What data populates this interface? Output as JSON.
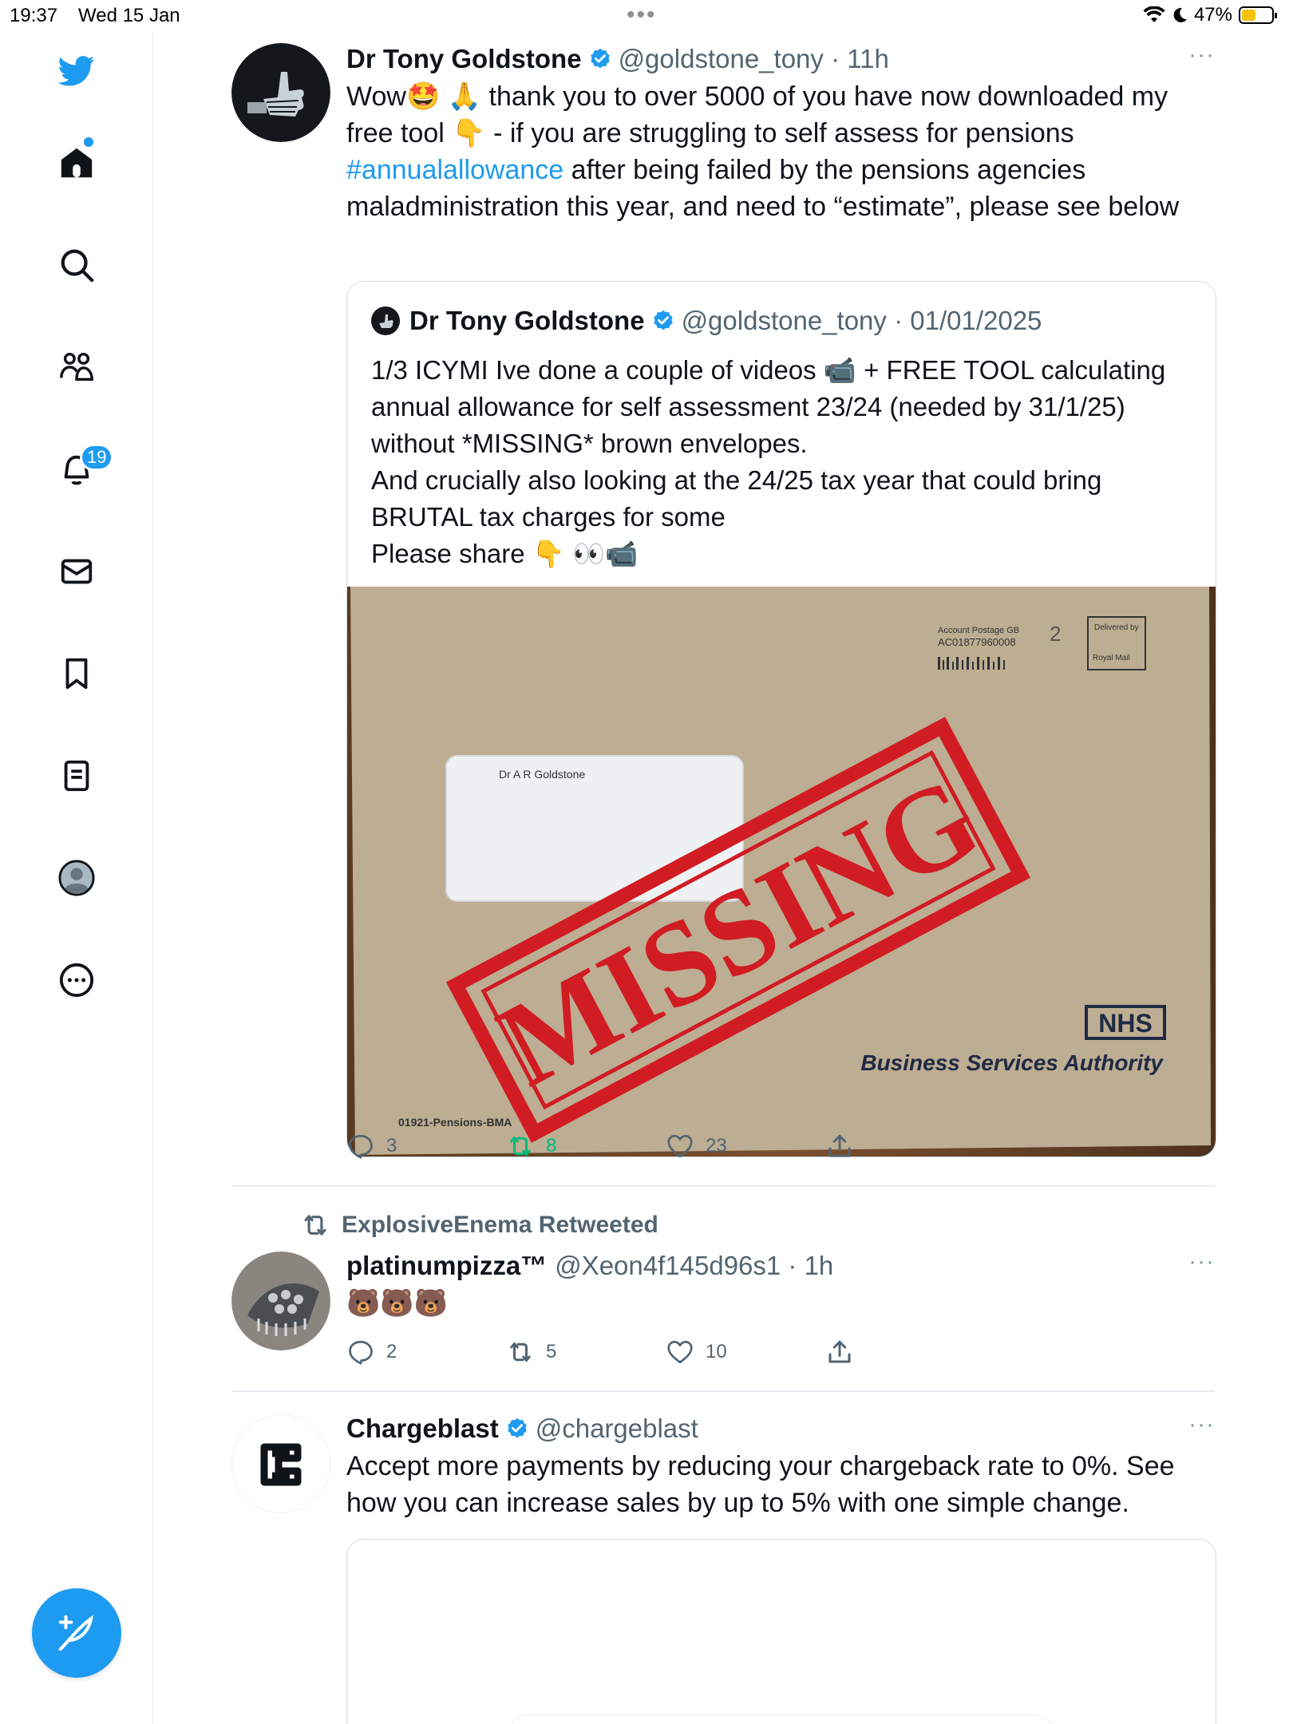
{
  "status_bar": {
    "time": "19:37",
    "date": "Wed 15 Jan",
    "battery": "47%",
    "battery_level": 0.47
  },
  "sidebar": {
    "notifications_badge": "19"
  },
  "tweets": [
    {
      "name": "Dr Tony Goldstone",
      "handle": "@goldstone_tony · 11h",
      "more": "···",
      "text_lines": [
        "Wow🤩 🙏 thank you to over 5000 of you have now downloaded my",
        "free tool 👇 - if you are struggling to self assess for pensions",
        "#annualallowance",
        " after being failed by the pensions agencies",
        "maladministration this year, and need to “estimate”, please see below"
      ],
      "quote": {
        "name": "Dr Tony Goldstone",
        "handle": "@goldstone_tony · 01/01/2025",
        "text_lines": [
          "1/3 ICYMI Ive done a couple of videos 📹 + FREE TOOL calculating",
          "annual allowance for self assessment 23/24 (needed by 31/1/25)",
          "without *MISSING* brown envelopes.",
          "And crucially also looking at the 24/25 tax year that could bring",
          "BRUTAL tax charges for some",
          "Please share 👇 👀📹"
        ],
        "image": {
          "postage_line1": "Account Postage GB",
          "postage_line2": "AC01877960008",
          "postage_num": "2",
          "delivered_by": "Delivered by",
          "royal_mail": "Royal Mail",
          "addressee": "Dr A R Goldstone",
          "stamp": "MISSING",
          "nhs": "NHS",
          "bsa": "Business Services Authority",
          "ref": "01921-Pensions-BMA"
        }
      },
      "actions": {
        "replies": "3",
        "retweets": "8",
        "likes": "23"
      }
    },
    {
      "retweeted_by": "ExplosiveEnema Retweeted",
      "name": "platinumpizza™",
      "handle": "@Xeon4f145d96s1 · 1h",
      "more": "···",
      "text": "🐻🐻🐻",
      "actions": {
        "replies": "2",
        "retweets": "5",
        "likes": "10"
      }
    },
    {
      "name": "Chargeblast",
      "handle": "@chargeblast",
      "more": "···",
      "text_lines": [
        "Accept more payments by reducing your chargeback rate to 0%. See",
        "how you can increase sales by up to 5% with one simple change."
      ]
    }
  ],
  "colors": {
    "accent": "#1d9bf0",
    "retweet_active": "#00ba7c",
    "muted": "#536471",
    "stamp_red": "#d01c22"
  }
}
